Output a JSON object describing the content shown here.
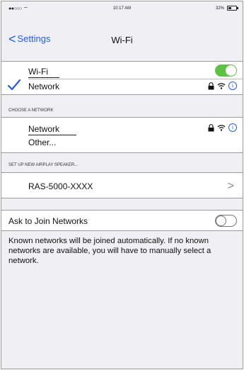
{
  "status_bar": {
    "signal": "●●○○○",
    "time": "10:17 AM",
    "battery_percent": "32%",
    "battery_level": 0.32
  },
  "nav": {
    "back_label": "Settings",
    "title": "Wi-Fi"
  },
  "wifi_group": {
    "wifi_label": "Wi-Fi",
    "wifi_on": true,
    "connected_network": "Network"
  },
  "choose_network": {
    "header": "CHOOSE A NETWORK",
    "network": "Network",
    "other": "Other..."
  },
  "airplay": {
    "header": "SET UP NEW AIRPLAY SPEAKER...",
    "speaker": "RAS-5000-XXXX"
  },
  "ask_join": {
    "label": "Ask to Join Networks",
    "on": false,
    "description": "Known networks will be joined automatically. If no known networks are available, you will have to manually select a network."
  },
  "colors": {
    "accent": "#1f5ff0",
    "toggle_on": "#5bc244"
  },
  "icons": [
    "check-icon",
    "lock-icon",
    "wifi-signal-icon",
    "info-icon",
    "chevron-right-icon",
    "chevron-left-icon"
  ]
}
